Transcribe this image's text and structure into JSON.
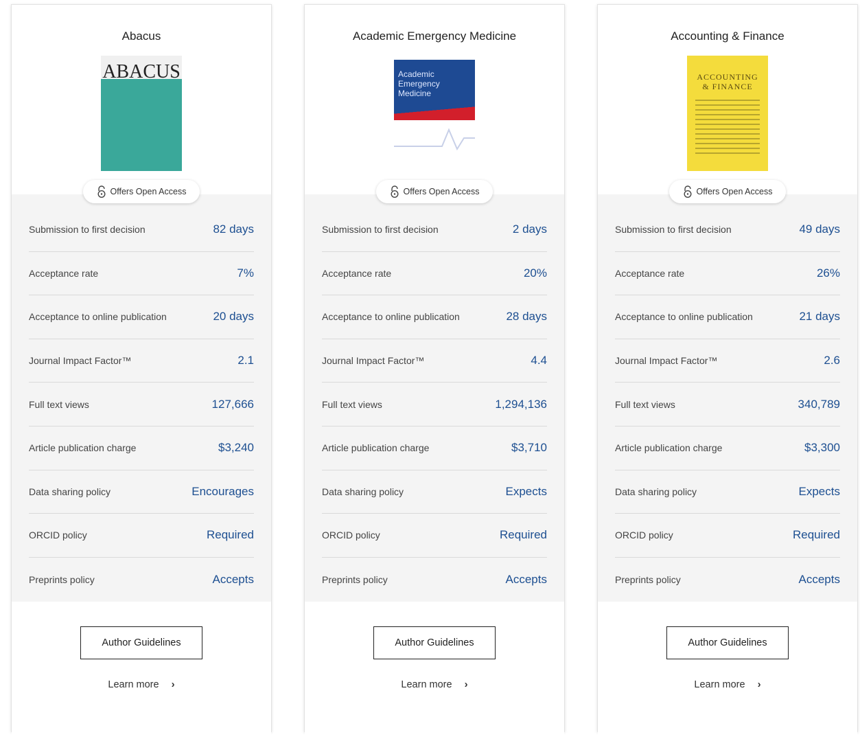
{
  "journals": [
    {
      "title": "Abacus",
      "cover_mast": "ABACUS",
      "open_access": "Offers Open Access",
      "metrics": [
        {
          "label": "Submission to first decision",
          "value": "82 days"
        },
        {
          "label": "Acceptance rate",
          "value": "7%"
        },
        {
          "label": "Acceptance to online publication",
          "value": "20 days"
        },
        {
          "label": "Journal Impact Factor™",
          "value": "2.1"
        },
        {
          "label": "Full text views",
          "value": "127,666"
        },
        {
          "label": "Article publication charge",
          "value": "$3,240"
        },
        {
          "label": "Data sharing policy",
          "value": "Encourages"
        },
        {
          "label": "ORCID policy",
          "value": "Required"
        },
        {
          "label": "Preprints policy",
          "value": "Accepts"
        }
      ],
      "guidelines_label": "Author Guidelines",
      "learn_more_label": "Learn more"
    },
    {
      "title": "Academic Emergency Medicine",
      "cover_mast": "Academic Emergency Medicine",
      "open_access": "Offers Open Access",
      "metrics": [
        {
          "label": "Submission to first decision",
          "value": "2 days"
        },
        {
          "label": "Acceptance rate",
          "value": "20%"
        },
        {
          "label": "Acceptance to online publication",
          "value": "28 days"
        },
        {
          "label": "Journal Impact Factor™",
          "value": "4.4"
        },
        {
          "label": "Full text views",
          "value": "1,294,136"
        },
        {
          "label": "Article publication charge",
          "value": "$3,710"
        },
        {
          "label": "Data sharing policy",
          "value": "Expects"
        },
        {
          "label": "ORCID policy",
          "value": "Required"
        },
        {
          "label": "Preprints policy",
          "value": "Accepts"
        }
      ],
      "guidelines_label": "Author Guidelines",
      "learn_more_label": "Learn more"
    },
    {
      "title": "Accounting & Finance",
      "cover_mast": "ACCOUNTING & FINANCE",
      "open_access": "Offers Open Access",
      "metrics": [
        {
          "label": "Submission to first decision",
          "value": "49 days"
        },
        {
          "label": "Acceptance rate",
          "value": "26%"
        },
        {
          "label": "Acceptance to online publication",
          "value": "21 days"
        },
        {
          "label": "Journal Impact Factor™",
          "value": "2.6"
        },
        {
          "label": "Full text views",
          "value": "340,789"
        },
        {
          "label": "Article publication charge",
          "value": "$3,300"
        },
        {
          "label": "Data sharing policy",
          "value": "Expects"
        },
        {
          "label": "ORCID policy",
          "value": "Required"
        },
        {
          "label": "Preprints policy",
          "value": "Accepts"
        }
      ],
      "guidelines_label": "Author Guidelines",
      "learn_more_label": "Learn more"
    }
  ],
  "icons": {
    "open_access": "unlock-icon",
    "learn_more": "chevron-right-icon"
  },
  "colors": {
    "value_text": "#1d4f91",
    "metrics_bg": "#f4f4f4"
  }
}
